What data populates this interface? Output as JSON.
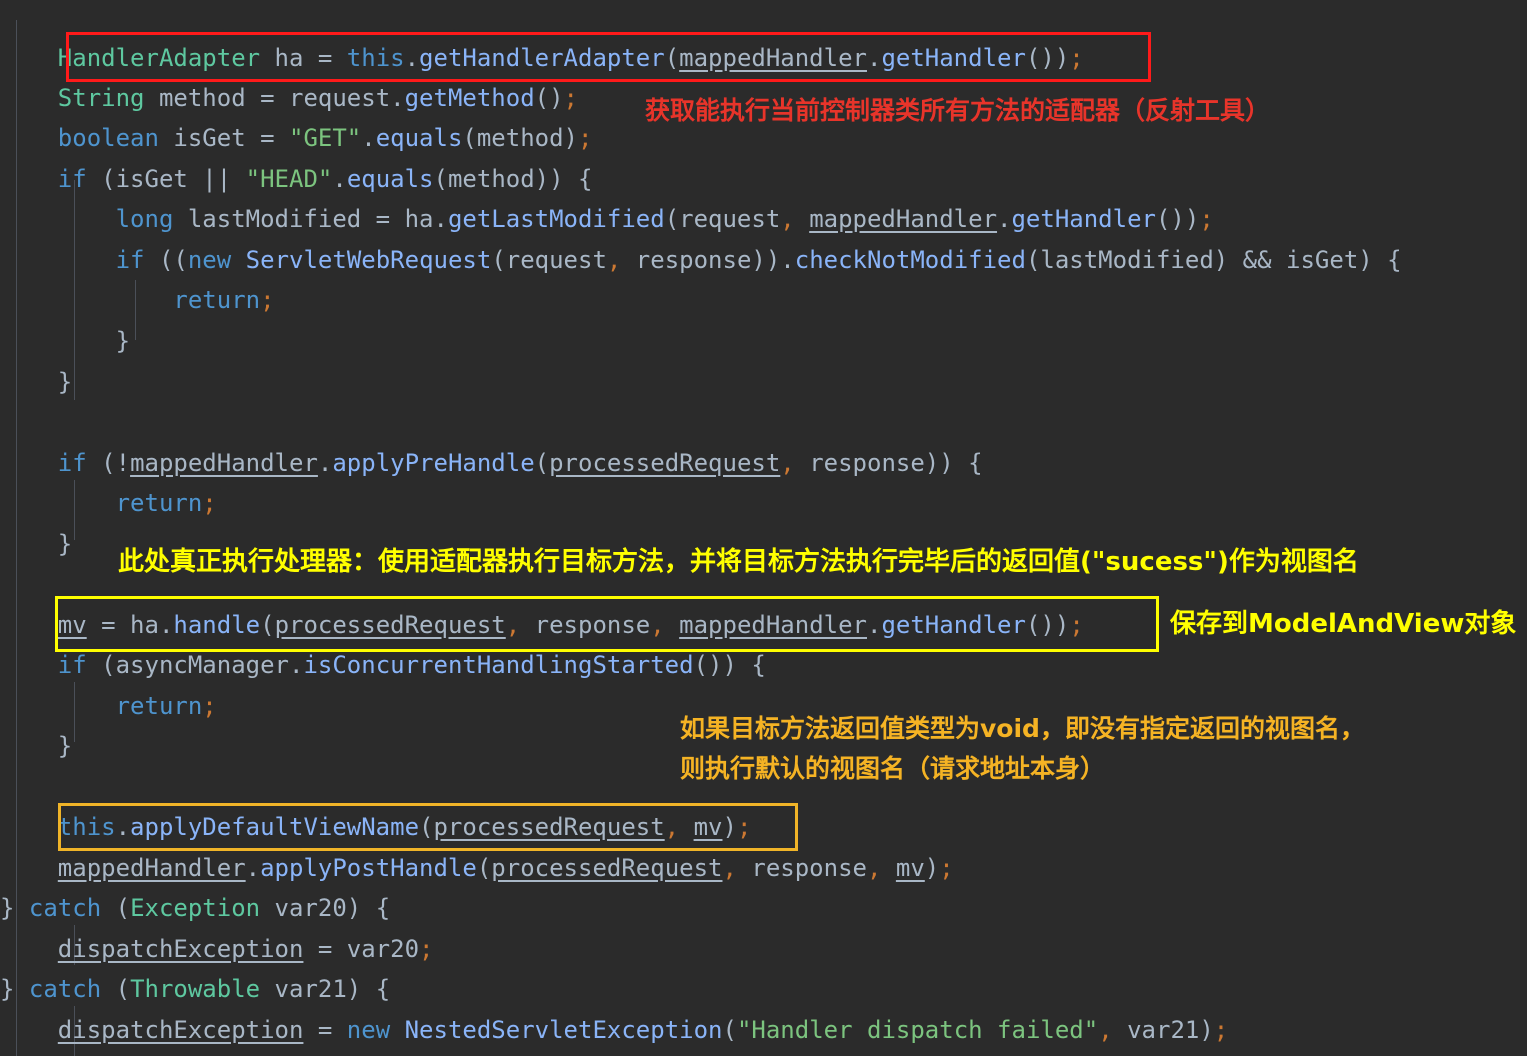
{
  "editor": {
    "theme": "darcula-dark",
    "background": "#2b2b2b",
    "default_text_color": "#a9b7c6",
    "language": "java",
    "font_size_px": 24,
    "line_height_px": 40
  },
  "colors": {
    "type": "#5ec8a0",
    "keyword": "#4e94ce",
    "method": "#8ab4f8",
    "string": "#7cc47f",
    "operator_punct": "#cc7832",
    "identifier": "#a9b7c6",
    "annotation_red": "#e8342a",
    "annotation_yellow": "#ffff00",
    "annotation_gold": "#f5b324",
    "box_red": "#ff1a1a",
    "box_yellow": "#ffff00",
    "box_gold": "#f0b428"
  },
  "code": {
    "lines": [
      {
        "id": "line-1",
        "text": "    HandlerAdapter ha = this.getHandlerAdapter(mappedHandler.getHandler());",
        "tokens": [
          {
            "t": "    ",
            "c": "t-plain"
          },
          {
            "t": "HandlerAdapter",
            "c": "t-type"
          },
          {
            "t": " ha = ",
            "c": "t-plain"
          },
          {
            "t": "this",
            "c": "t-kw"
          },
          {
            "t": ".",
            "c": "t-plain"
          },
          {
            "t": "getHandlerAdapter",
            "c": "t-meth"
          },
          {
            "t": "(",
            "c": "t-plain"
          },
          {
            "t": "mappedHandler",
            "c": "t-field"
          },
          {
            "t": ".",
            "c": "t-plain"
          },
          {
            "t": "getHandler",
            "c": "t-meth"
          },
          {
            "t": "())",
            "c": "t-plain"
          },
          {
            "t": ";",
            "c": "t-op"
          }
        ]
      },
      {
        "id": "line-2",
        "text": "    String method = request.getMethod();",
        "tokens": [
          {
            "t": "    ",
            "c": "t-plain"
          },
          {
            "t": "String",
            "c": "t-type"
          },
          {
            "t": " method = request.",
            "c": "t-plain"
          },
          {
            "t": "getMethod",
            "c": "t-meth"
          },
          {
            "t": "()",
            "c": "t-plain"
          },
          {
            "t": ";",
            "c": "t-op"
          }
        ]
      },
      {
        "id": "line-3",
        "text": "    boolean isGet = \"GET\".equals(method);",
        "tokens": [
          {
            "t": "    ",
            "c": "t-plain"
          },
          {
            "t": "boolean",
            "c": "t-kw"
          },
          {
            "t": " isGet = ",
            "c": "t-plain"
          },
          {
            "t": "\"GET\"",
            "c": "t-str"
          },
          {
            "t": ".",
            "c": "t-plain"
          },
          {
            "t": "equals",
            "c": "t-meth"
          },
          {
            "t": "(method)",
            "c": "t-plain"
          },
          {
            "t": ";",
            "c": "t-op"
          }
        ]
      },
      {
        "id": "line-4",
        "text": "    if (isGet || \"HEAD\".equals(method)) {",
        "tokens": [
          {
            "t": "    ",
            "c": "t-plain"
          },
          {
            "t": "if",
            "c": "t-kw"
          },
          {
            "t": " (isGet || ",
            "c": "t-plain"
          },
          {
            "t": "\"HEAD\"",
            "c": "t-str"
          },
          {
            "t": ".",
            "c": "t-plain"
          },
          {
            "t": "equals",
            "c": "t-meth"
          },
          {
            "t": "(method)) {",
            "c": "t-plain"
          }
        ]
      },
      {
        "id": "line-5",
        "text": "        long lastModified = ha.getLastModified(request, mappedHandler.getHandler());",
        "tokens": [
          {
            "t": "        ",
            "c": "t-plain"
          },
          {
            "t": "long",
            "c": "t-kw"
          },
          {
            "t": " lastModified = ha.",
            "c": "t-plain"
          },
          {
            "t": "getLastModified",
            "c": "t-meth"
          },
          {
            "t": "(request",
            "c": "t-plain"
          },
          {
            "t": ",",
            "c": "t-op"
          },
          {
            "t": " ",
            "c": "t-plain"
          },
          {
            "t": "mappedHandler",
            "c": "t-field"
          },
          {
            "t": ".",
            "c": "t-plain"
          },
          {
            "t": "getHandler",
            "c": "t-meth"
          },
          {
            "t": "())",
            "c": "t-plain"
          },
          {
            "t": ";",
            "c": "t-op"
          }
        ]
      },
      {
        "id": "line-6",
        "text": "        if ((new ServletWebRequest(request, response)).checkNotModified(lastModified) && isGet) {",
        "tokens": [
          {
            "t": "        ",
            "c": "t-plain"
          },
          {
            "t": "if",
            "c": "t-kw"
          },
          {
            "t": " ((",
            "c": "t-plain"
          },
          {
            "t": "new",
            "c": "t-kw"
          },
          {
            "t": " ",
            "c": "t-plain"
          },
          {
            "t": "ServletWebRequest",
            "c": "t-meth"
          },
          {
            "t": "(request",
            "c": "t-plain"
          },
          {
            "t": ",",
            "c": "t-op"
          },
          {
            "t": " response)).",
            "c": "t-plain"
          },
          {
            "t": "checkNotModified",
            "c": "t-meth"
          },
          {
            "t": "(lastModified) && isGet) {",
            "c": "t-plain"
          }
        ]
      },
      {
        "id": "line-7",
        "text": "            return;",
        "tokens": [
          {
            "t": "            ",
            "c": "t-plain"
          },
          {
            "t": "return",
            "c": "t-kw"
          },
          {
            "t": ";",
            "c": "t-op"
          }
        ]
      },
      {
        "id": "line-8",
        "text": "        }",
        "tokens": [
          {
            "t": "        }",
            "c": "t-plain"
          }
        ]
      },
      {
        "id": "line-9",
        "text": "    }",
        "tokens": [
          {
            "t": "    }",
            "c": "t-plain"
          }
        ]
      },
      {
        "id": "line-10",
        "text": "",
        "tokens": []
      },
      {
        "id": "line-11",
        "text": "    if (!mappedHandler.applyPreHandle(processedRequest, response)) {",
        "tokens": [
          {
            "t": "    ",
            "c": "t-plain"
          },
          {
            "t": "if",
            "c": "t-kw"
          },
          {
            "t": " (!",
            "c": "t-plain"
          },
          {
            "t": "mappedHandler",
            "c": "t-field"
          },
          {
            "t": ".",
            "c": "t-plain"
          },
          {
            "t": "applyPreHandle",
            "c": "t-meth"
          },
          {
            "t": "(",
            "c": "t-plain"
          },
          {
            "t": "processedRequest",
            "c": "t-local"
          },
          {
            "t": ",",
            "c": "t-op"
          },
          {
            "t": " response)) {",
            "c": "t-plain"
          }
        ]
      },
      {
        "id": "line-12",
        "text": "        return;",
        "tokens": [
          {
            "t": "        ",
            "c": "t-plain"
          },
          {
            "t": "return",
            "c": "t-kw"
          },
          {
            "t": ";",
            "c": "t-op"
          }
        ]
      },
      {
        "id": "line-13",
        "text": "    }",
        "tokens": [
          {
            "t": "    }",
            "c": "t-plain"
          }
        ]
      },
      {
        "id": "line-14",
        "text": "",
        "tokens": []
      },
      {
        "id": "line-15",
        "text": "    mv = ha.handle(processedRequest, response, mappedHandler.getHandler());",
        "tokens": [
          {
            "t": "    ",
            "c": "t-plain"
          },
          {
            "t": "mv",
            "c": "t-local"
          },
          {
            "t": " = ha.",
            "c": "t-plain"
          },
          {
            "t": "handle",
            "c": "t-meth"
          },
          {
            "t": "(",
            "c": "t-plain"
          },
          {
            "t": "processedRequest",
            "c": "t-local"
          },
          {
            "t": ",",
            "c": "t-op"
          },
          {
            "t": " response",
            "c": "t-plain"
          },
          {
            "t": ",",
            "c": "t-op"
          },
          {
            "t": " ",
            "c": "t-plain"
          },
          {
            "t": "mappedHandler",
            "c": "t-field"
          },
          {
            "t": ".",
            "c": "t-plain"
          },
          {
            "t": "getHandler",
            "c": "t-meth"
          },
          {
            "t": "())",
            "c": "t-plain"
          },
          {
            "t": ";",
            "c": "t-op"
          }
        ]
      },
      {
        "id": "line-16",
        "text": "    if (asyncManager.isConcurrentHandlingStarted()) {",
        "tokens": [
          {
            "t": "    ",
            "c": "t-plain"
          },
          {
            "t": "if",
            "c": "t-kw"
          },
          {
            "t": " (asyncManager.",
            "c": "t-plain"
          },
          {
            "t": "isConcurrentHandlingStarted",
            "c": "t-meth"
          },
          {
            "t": "()) {",
            "c": "t-plain"
          }
        ]
      },
      {
        "id": "line-17",
        "text": "        return;",
        "tokens": [
          {
            "t": "        ",
            "c": "t-plain"
          },
          {
            "t": "return",
            "c": "t-kw"
          },
          {
            "t": ";",
            "c": "t-op"
          }
        ]
      },
      {
        "id": "line-18",
        "text": "    }",
        "tokens": [
          {
            "t": "    }",
            "c": "t-plain"
          }
        ]
      },
      {
        "id": "line-19",
        "text": "",
        "tokens": []
      },
      {
        "id": "line-20",
        "text": "    this.applyDefaultViewName(processedRequest, mv);",
        "tokens": [
          {
            "t": "    ",
            "c": "t-plain"
          },
          {
            "t": "this",
            "c": "t-kw"
          },
          {
            "t": ".",
            "c": "t-plain"
          },
          {
            "t": "applyDefaultViewName",
            "c": "t-meth"
          },
          {
            "t": "(",
            "c": "t-plain"
          },
          {
            "t": "processedRequest",
            "c": "t-local"
          },
          {
            "t": ",",
            "c": "t-op"
          },
          {
            "t": " ",
            "c": "t-plain"
          },
          {
            "t": "mv",
            "c": "t-local"
          },
          {
            "t": ")",
            "c": "t-plain"
          },
          {
            "t": ";",
            "c": "t-op"
          }
        ]
      },
      {
        "id": "line-21",
        "text": "    mappedHandler.applyPostHandle(processedRequest, response, mv);",
        "tokens": [
          {
            "t": "    ",
            "c": "t-plain"
          },
          {
            "t": "mappedHandler",
            "c": "t-field"
          },
          {
            "t": ".",
            "c": "t-plain"
          },
          {
            "t": "applyPostHandle",
            "c": "t-meth"
          },
          {
            "t": "(",
            "c": "t-plain"
          },
          {
            "t": "processedRequest",
            "c": "t-local"
          },
          {
            "t": ",",
            "c": "t-op"
          },
          {
            "t": " response",
            "c": "t-plain"
          },
          {
            "t": ",",
            "c": "t-op"
          },
          {
            "t": " ",
            "c": "t-plain"
          },
          {
            "t": "mv",
            "c": "t-local"
          },
          {
            "t": ")",
            "c": "t-plain"
          },
          {
            "t": ";",
            "c": "t-op"
          }
        ]
      },
      {
        "id": "line-22",
        "text": "} catch (Exception var20) {",
        "tokens": [
          {
            "t": "} ",
            "c": "t-plain"
          },
          {
            "t": "catch",
            "c": "t-kw"
          },
          {
            "t": " (",
            "c": "t-plain"
          },
          {
            "t": "Exception",
            "c": "t-type"
          },
          {
            "t": " var20) {",
            "c": "t-plain"
          }
        ]
      },
      {
        "id": "line-23",
        "text": "    dispatchException = var20;",
        "tokens": [
          {
            "t": "    ",
            "c": "t-plain"
          },
          {
            "t": "dispatchException",
            "c": "t-local"
          },
          {
            "t": " = var20",
            "c": "t-plain"
          },
          {
            "t": ";",
            "c": "t-op"
          }
        ]
      },
      {
        "id": "line-24",
        "text": "} catch (Throwable var21) {",
        "tokens": [
          {
            "t": "} ",
            "c": "t-plain"
          },
          {
            "t": "catch",
            "c": "t-kw"
          },
          {
            "t": " (",
            "c": "t-plain"
          },
          {
            "t": "Throwable",
            "c": "t-type"
          },
          {
            "t": " var21) {",
            "c": "t-plain"
          }
        ]
      },
      {
        "id": "line-25",
        "text": "    dispatchException = new NestedServletException(\"Handler dispatch failed\", var21);",
        "tokens": [
          {
            "t": "    ",
            "c": "t-plain"
          },
          {
            "t": "dispatchException",
            "c": "t-local"
          },
          {
            "t": " = ",
            "c": "t-plain"
          },
          {
            "t": "new",
            "c": "t-kw"
          },
          {
            "t": " ",
            "c": "t-plain"
          },
          {
            "t": "NestedServletException",
            "c": "t-meth"
          },
          {
            "t": "(",
            "c": "t-plain"
          },
          {
            "t": "\"Handler dispatch failed\"",
            "c": "t-str"
          },
          {
            "t": ",",
            "c": "t-op"
          },
          {
            "t": " var21)",
            "c": "t-plain"
          },
          {
            "t": ";",
            "c": "t-op"
          }
        ]
      }
    ]
  },
  "annotations": {
    "red_get_adapter": "获取能执行当前控制器类所有方法的适配器（反射工具）",
    "yellow_execute_handler": "此处真正执行处理器：使用适配器执行目标方法，并将目标方法执行完毕后的返回值(\"sucess\")作为视图名",
    "yellow_save_mav": "保存到ModelAndView对象",
    "gold_default_view_line1": "如果目标方法返回值类型为void，即没有指定返回的视图名，",
    "gold_default_view_line2": "则执行默认的视图名（请求地址本身）"
  },
  "highlight_boxes": [
    {
      "id": "box-handler-adapter",
      "color": "#ff1a1a",
      "target_line": "line-1"
    },
    {
      "id": "box-mv-handle",
      "color": "#ffff00",
      "target_line": "line-15"
    },
    {
      "id": "box-apply-default-view-name",
      "color": "#f0b428",
      "target_line": "line-20"
    }
  ]
}
